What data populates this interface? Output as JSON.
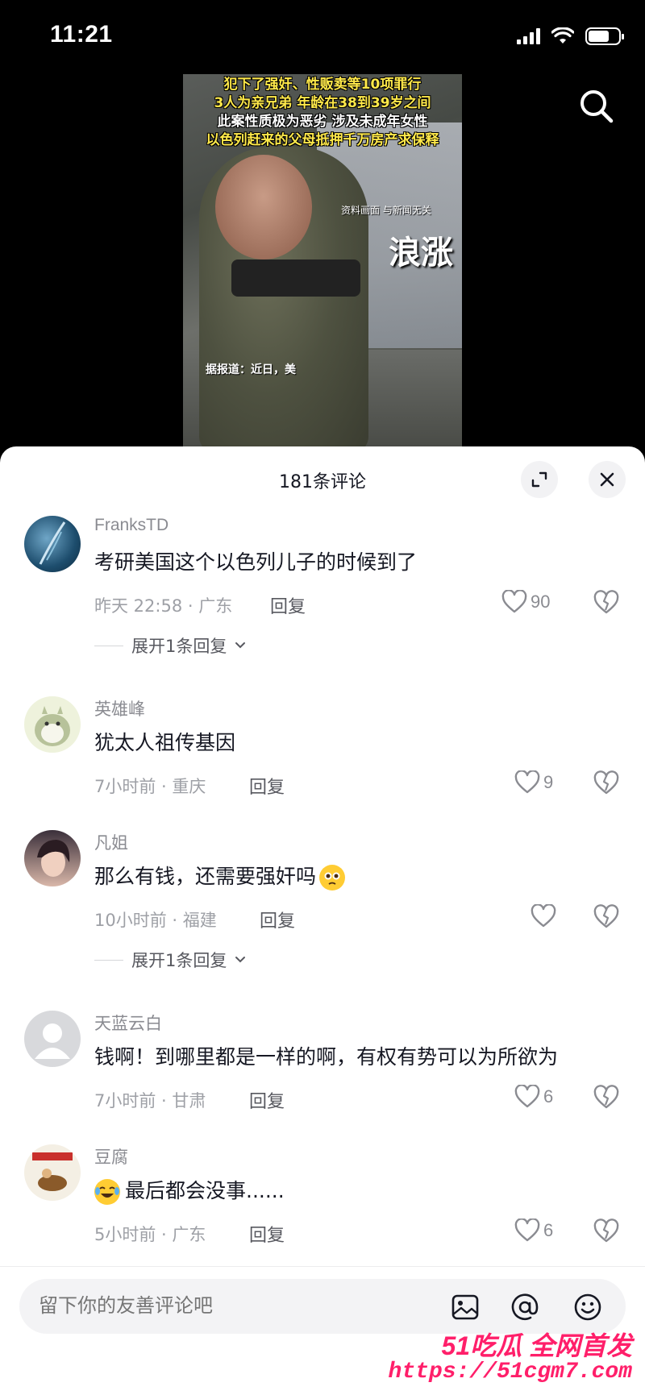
{
  "status_bar": {
    "time": "11:21",
    "battery_level": 0.7
  },
  "video": {
    "caption_lines": [
      "犯下了强奸、性贩卖等10项罪行",
      "3人为亲兄弟 年龄在38到39岁之间",
      "此案性质极为恶劣 涉及未成年女性",
      "以色列赶来的父母抵押千万房产求保释"
    ],
    "disclaimer": "资料画面 与新闻无关",
    "logo_text": "浪涨",
    "report_text": "据报道：近日，美"
  },
  "sheet": {
    "title": "181条评论"
  },
  "comments": [
    {
      "user": "FranksTD",
      "text": "考研美国这个以色列儿子的时候到了",
      "meta": "昨天 22:58 · 广东",
      "reply": "回复",
      "likes": "90",
      "expand": "展开1条回复"
    },
    {
      "user": "英雄峰",
      "text": "犹太人祖传基因",
      "meta": "7小时前 · 重庆",
      "reply": "回复",
      "likes": "9"
    },
    {
      "user": "凡姐",
      "text": "那么有钱，还需要强奸吗",
      "meta": "10小时前 · 福建",
      "reply": "回复",
      "likes": "",
      "expand": "展开1条回复"
    },
    {
      "user": "天蓝云白",
      "text": "钱啊！到哪里都是一样的啊，有权有势可以为所欲为",
      "meta": "7小时前 · 甘肃",
      "reply": "回复",
      "likes": "6"
    },
    {
      "user": "豆腐",
      "text": "最后都会没事......",
      "meta": "5小时前 · 广东",
      "reply": "回复",
      "likes": "6"
    }
  ],
  "input": {
    "placeholder": "留下你的友善评论吧"
  },
  "watermark": {
    "top": "51吃瓜 全网首发",
    "bottom": "https://51cgm7.com"
  },
  "colors": {
    "accent": "#ff1f6a",
    "text_primary": "#161823",
    "text_secondary": "#8a8b91"
  }
}
